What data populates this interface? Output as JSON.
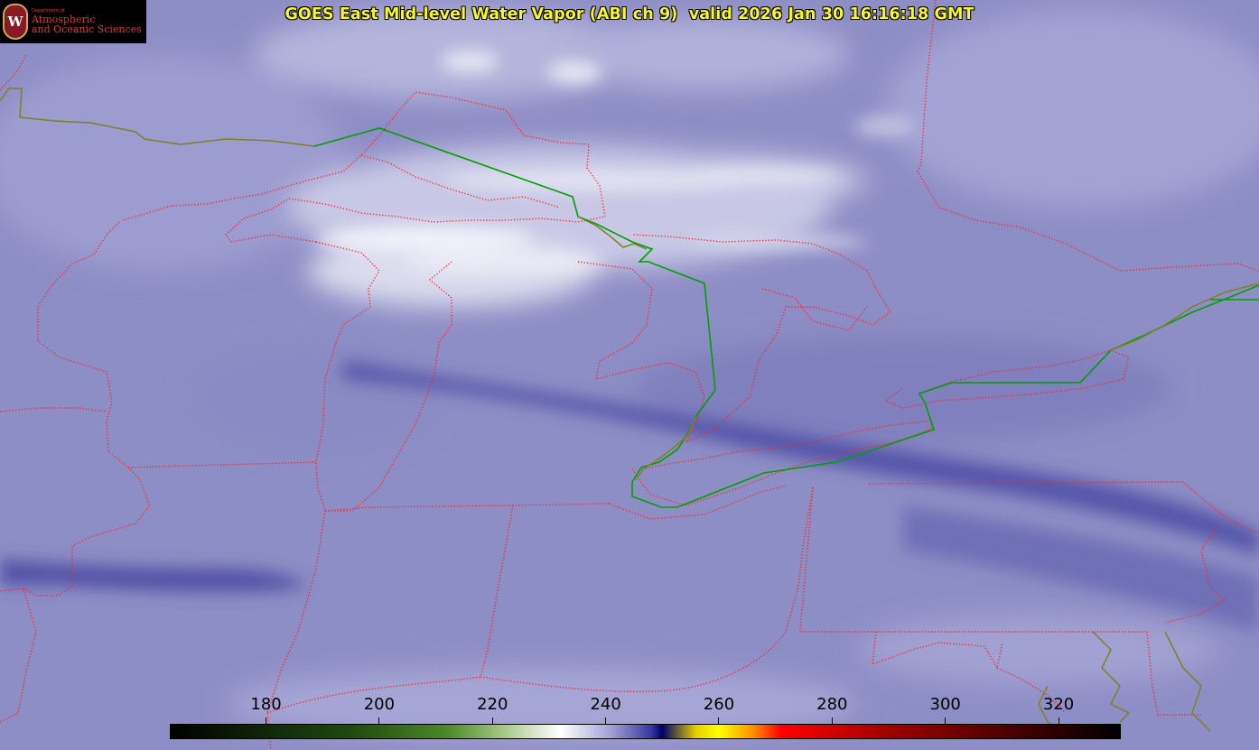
{
  "title": "GOES East Mid-level Water Vapor (ABI ch 9)  valid 2026 Jan 30 16:16:18 GMT",
  "logo": {
    "department": "Department of",
    "line1": "Atmospheric",
    "line2": "and Oceanic Sciences",
    "seal_letter": "W"
  },
  "colorbar": {
    "ticks": [
      "180",
      "200",
      "220",
      "240",
      "260",
      "280",
      "300",
      "320"
    ],
    "range": [
      163,
      331
    ],
    "stops": [
      {
        "value": 163,
        "color": "#000000"
      },
      {
        "value": 195,
        "color": "#1e4a10"
      },
      {
        "value": 212,
        "color": "#4c8a28"
      },
      {
        "value": 222,
        "color": "#a8c88a"
      },
      {
        "value": 232,
        "color": "#ffffff"
      },
      {
        "value": 241,
        "color": "#a0a0d6"
      },
      {
        "value": 248,
        "color": "#3838a0"
      },
      {
        "value": 250,
        "color": "#000066"
      },
      {
        "value": 256,
        "color": "#e8d000"
      },
      {
        "value": 260,
        "color": "#ffff00"
      },
      {
        "value": 266,
        "color": "#ff9000"
      },
      {
        "value": 271,
        "color": "#ff0000"
      },
      {
        "value": 290,
        "color": "#a00000"
      },
      {
        "value": 331,
        "color": "#000000"
      }
    ]
  },
  "colors": {
    "background": "#8e8ec6",
    "boundary_dotted": "#ff2020",
    "international_border": "#00a000",
    "coastline": "#808020",
    "title_text": "#f6f62a"
  }
}
